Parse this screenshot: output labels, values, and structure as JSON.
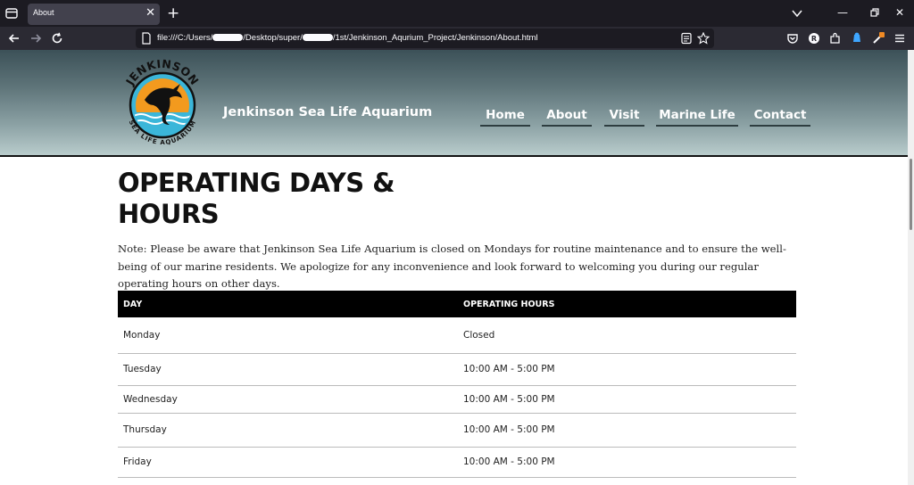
{
  "browser": {
    "tab_title": "About",
    "url_prefix": "file:///C:/Users/",
    "url_mid1": "/Desktop/super/",
    "url_mid2": "/1st/Jenkinson_Aqurium_Project/Jenkinson/About.html",
    "icons": [
      "tab-list-icon",
      "close-icon",
      "plus-icon",
      "chevron-down-icon",
      "minimize-icon",
      "restore-icon",
      "close-window-icon",
      "back-icon",
      "forward-icon",
      "reload-icon",
      "page-icon",
      "reader-view-icon",
      "star-icon",
      "pocket-icon",
      "profile-icon",
      "extensions-icon",
      "addon-icon",
      "addon-badge-icon",
      "menu-icon"
    ],
    "profile_letter": "R"
  },
  "header": {
    "logo_text_top": "JENKINSON",
    "logo_text_bottom": "SEA LIFE AQUARIUM",
    "site_title": "Jenkinson Sea Life Aquarium",
    "nav": [
      "Home",
      "About",
      "Visit",
      "Marine Life",
      "Contact"
    ]
  },
  "main": {
    "heading": "OPERATING DAYS & HOURS",
    "note": "Note: Please be aware that Jenkinson Sea Life Aquarium is closed on Mondays for routine maintenance and to ensure the well-being of our marine residents. We apologize for any inconvenience and look forward to welcoming you during our regular operating hours on other days.",
    "table": {
      "headers": [
        "DAY",
        "OPERATING HOURS"
      ],
      "rows": [
        [
          "Monday",
          "Closed"
        ],
        [
          "Tuesday",
          "10:00 AM - 5:00 PM"
        ],
        [
          "Wednesday",
          "10:00 AM - 5:00 PM"
        ],
        [
          "Thursday",
          "10:00 AM - 5:00 PM"
        ],
        [
          "Friday",
          "10:00 AM - 5:00 PM"
        ]
      ]
    }
  },
  "colors": {
    "chrome_dark": "#1c1b22",
    "chrome_toolbar": "#2b2a33",
    "header_top": "#3c5158",
    "header_bottom": "#b9cccc",
    "logo_sun": "#f39a1e",
    "logo_water": "#3bb6d9"
  }
}
